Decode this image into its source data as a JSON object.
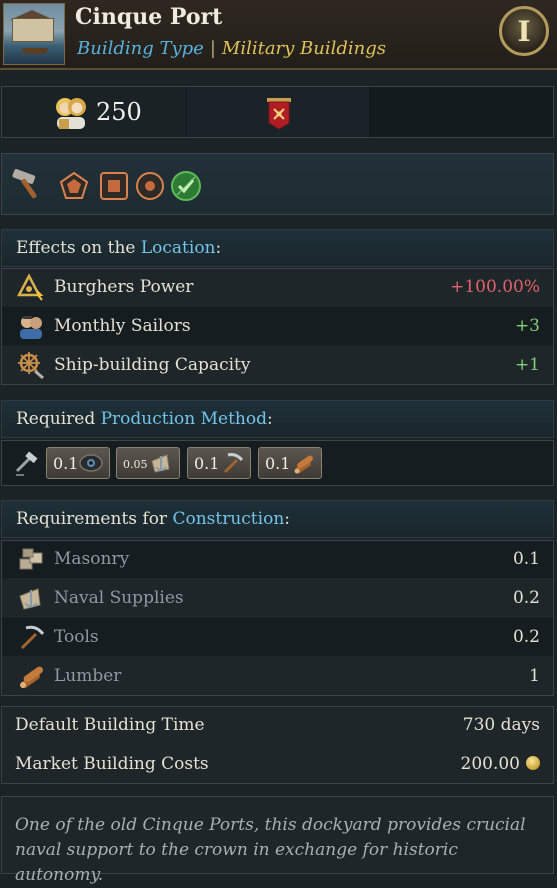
{
  "header": {
    "title": "Cinque Port",
    "building_type_label": "Building Type",
    "separator": "|",
    "category": "Military Buildings",
    "info_button_label": "I"
  },
  "population": {
    "value": "250",
    "icon": "burghers-pop-icon",
    "estate_icon": "banner-icon"
  },
  "category_icons": [
    "hammer-icon",
    "pentagon-icon",
    "square-icon",
    "circle-icon",
    "check-icon"
  ],
  "effects": {
    "header_prefix": "Effects on the",
    "header_highlight": "Location",
    "header_suffix": ":",
    "items": [
      {
        "label": "Burghers Power",
        "value": "+100.00%",
        "icon": "burghers-power-icon",
        "color": "#e2626b"
      },
      {
        "label": "Monthly Sailors",
        "value": "+3",
        "icon": "sailors-icon",
        "color": "#7fd17a"
      },
      {
        "label": "Ship-building Capacity",
        "value": "+1",
        "icon": "ship-wheel-icon",
        "color": "#7fd17a"
      }
    ]
  },
  "production": {
    "header_prefix": "Required",
    "header_highlight": "Production Method",
    "header_suffix": ":",
    "method_icon": "hammer-method-icon",
    "inputs": [
      {
        "amount": "0.1",
        "icon": "eye-goods-icon"
      },
      {
        "amount": "0.05",
        "icon": "naval-supplies-icon"
      },
      {
        "amount": "0.1",
        "icon": "tools-icon"
      },
      {
        "amount": "0.1",
        "icon": "lumber-icon"
      }
    ]
  },
  "construction": {
    "header_prefix": "Requirements for",
    "header_highlight": "Construction",
    "header_suffix": ":",
    "items": [
      {
        "label": "Masonry",
        "value": "0.1",
        "icon": "masonry-icon"
      },
      {
        "label": "Naval Supplies",
        "value": "0.2",
        "icon": "naval-supplies-icon"
      },
      {
        "label": "Tools",
        "value": "0.2",
        "icon": "tools-icon"
      },
      {
        "label": "Lumber",
        "value": "1",
        "icon": "lumber-icon"
      }
    ]
  },
  "info": {
    "build_time_label": "Default Building Time",
    "build_time_value": "730 days",
    "cost_label": "Market Building Costs",
    "cost_value": "200.00",
    "cost_icon": "gold-coin-icon"
  },
  "description": "One of the old Cinque Ports, this dockyard provides crucial naval support to the crown in exchange for historic autonomy."
}
